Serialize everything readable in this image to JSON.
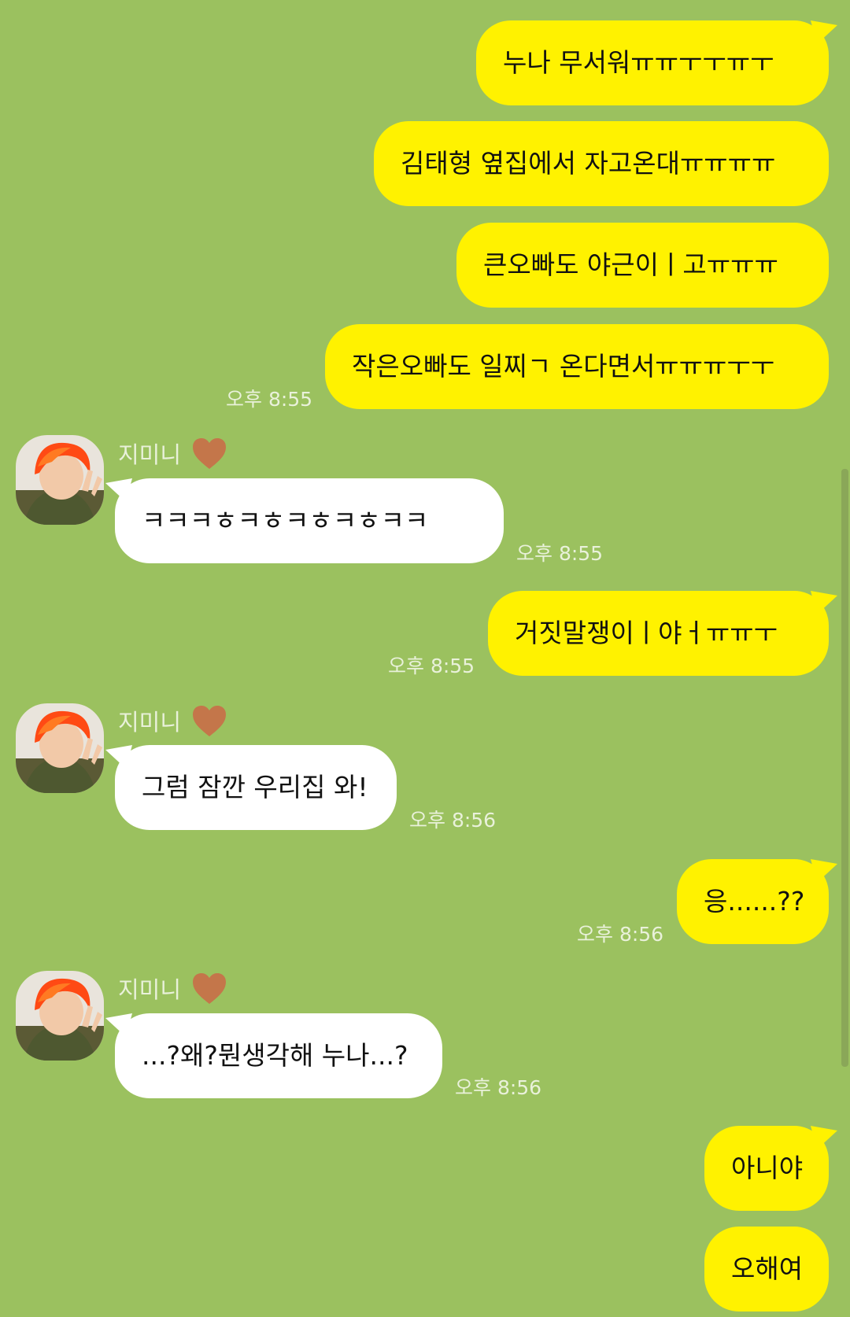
{
  "messages": [
    {
      "from": "me",
      "text": "누나 무서워ㅠㅠㅜㅜㅠㅜ"
    },
    {
      "from": "me",
      "text": "김태형 옆집에서 자고온대ㅠㅠㅠㅠ"
    },
    {
      "from": "me",
      "text": "큰오빠도 야근이ㅣ고ㅠㅠㅠ"
    },
    {
      "from": "me",
      "text": "작은오빠도 일찌ㄱ 온다면서ㅠㅠㅠㅜㅜ",
      "time": "오후 8:55"
    },
    {
      "from": "them",
      "sender": "지미니",
      "text": "ㅋㅋㅋㅎㅋㅎㅋㅎㅋㅎㅋㅋ",
      "time": "오후 8:55"
    },
    {
      "from": "me",
      "text": "거짓말쟁이ㅣ야ㅓㅠㅠㅜ",
      "time": "오후 8:55"
    },
    {
      "from": "them",
      "sender": "지미니",
      "text": "그럼 잠깐 우리집 와!",
      "time": "오후 8:56"
    },
    {
      "from": "me",
      "text": "응......??",
      "time": "오후 8:56"
    },
    {
      "from": "them",
      "sender": "지미니",
      "text": "...?왜?뭔생각해 누나...?",
      "time": "오후 8:56"
    },
    {
      "from": "me",
      "text": "아니야"
    },
    {
      "from": "me",
      "text": "오해여"
    }
  ],
  "icons": {
    "sender_heart": "brown-heart-icon",
    "avatar": "profile-avatar"
  },
  "colors": {
    "background": "#9bc15f",
    "my_bubble": "#fff200",
    "their_bubble": "#ffffff",
    "heart": "#c4764a"
  }
}
